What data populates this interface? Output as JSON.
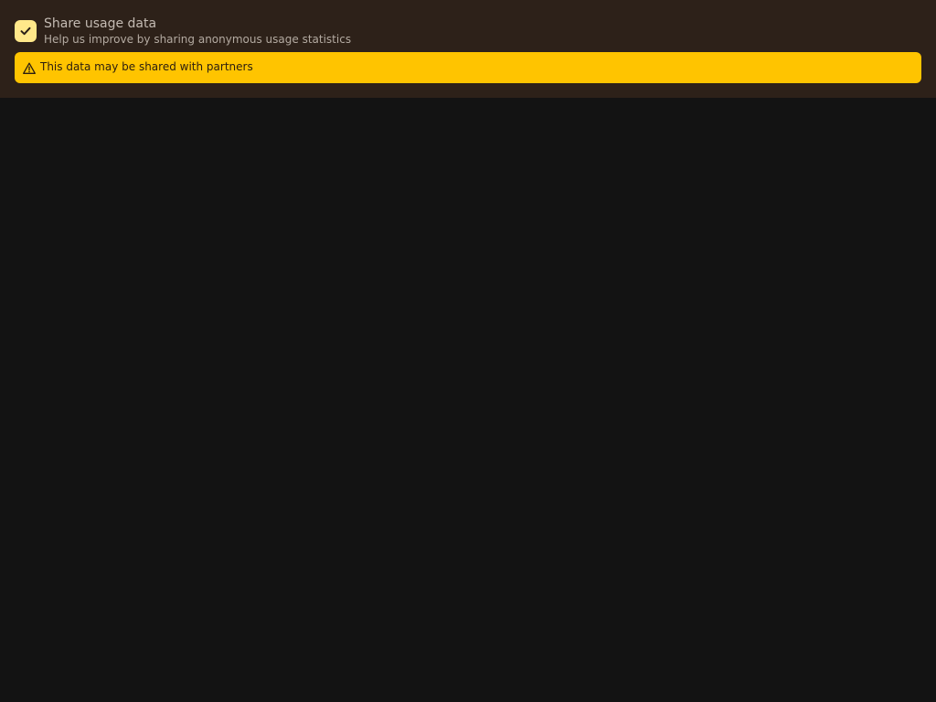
{
  "consent": {
    "title": "Share usage data",
    "description": "Help us improve by sharing anonymous usage statistics",
    "checked": true,
    "checkbox_icon": "check-icon"
  },
  "warning": {
    "icon": "warning-triangle-icon",
    "text": "This data may be shared with partners"
  },
  "colors": {
    "background": "#131313",
    "panel": "#2d2119",
    "checkbox": "#ffe88a",
    "warning": "#ffc400"
  }
}
